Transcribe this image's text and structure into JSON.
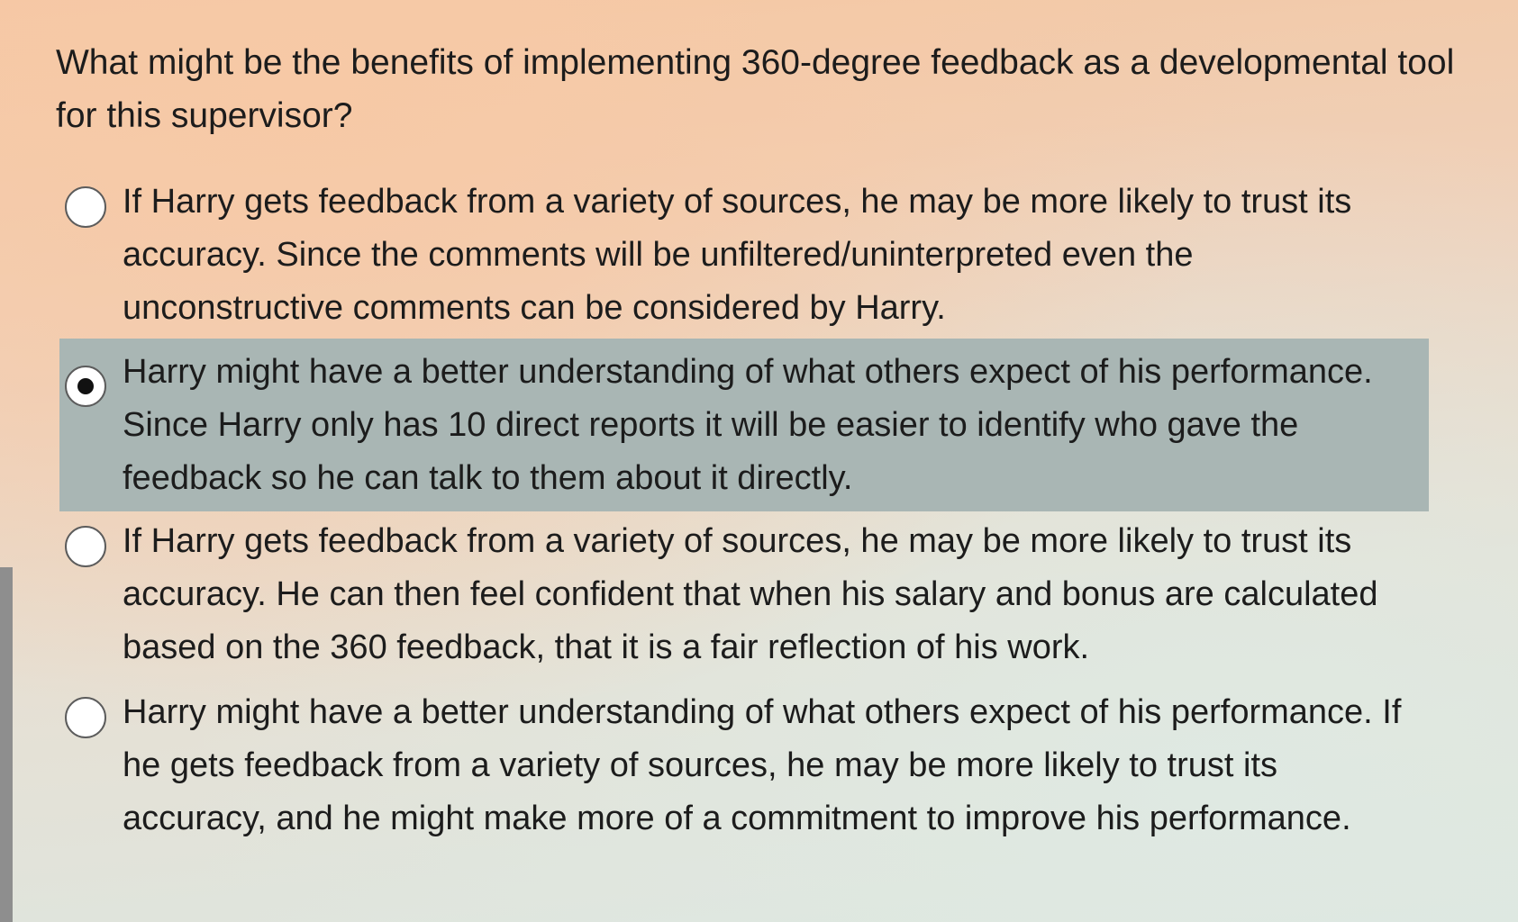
{
  "question": {
    "text": "What might be the benefits of implementing 360-degree feedback as a developmental tool for this supervisor?"
  },
  "options": [
    {
      "text": "If Harry gets feedback from a variety of sources, he may be more likely to trust its accuracy. Since the comments will be unfiltered/uninterpreted even the unconstructive comments can be considered by Harry.",
      "selected": false
    },
    {
      "text": "Harry might have a better understanding of what others expect of his performance. Since Harry only has 10 direct reports it will be easier to identify who gave the feedback so he can talk to them about it directly.",
      "selected": true
    },
    {
      "text": "If Harry gets feedback from a variety of sources, he may be more likely to trust its accuracy. He can then feel confident that when his salary and bonus are calculated based on the 360 feedback, that it is a fair reflection of his work.",
      "selected": false
    },
    {
      "text": "Harry might have a better understanding of what others expect of his performance. If he gets feedback from a variety of sources, he may be more likely to trust its accuracy, and he might make more of a commitment to improve his performance.",
      "selected": false
    }
  ],
  "colors": {
    "selected_background": "#a9b6b4",
    "radio_border": "#5c5c5c",
    "radio_dot": "#111111"
  }
}
